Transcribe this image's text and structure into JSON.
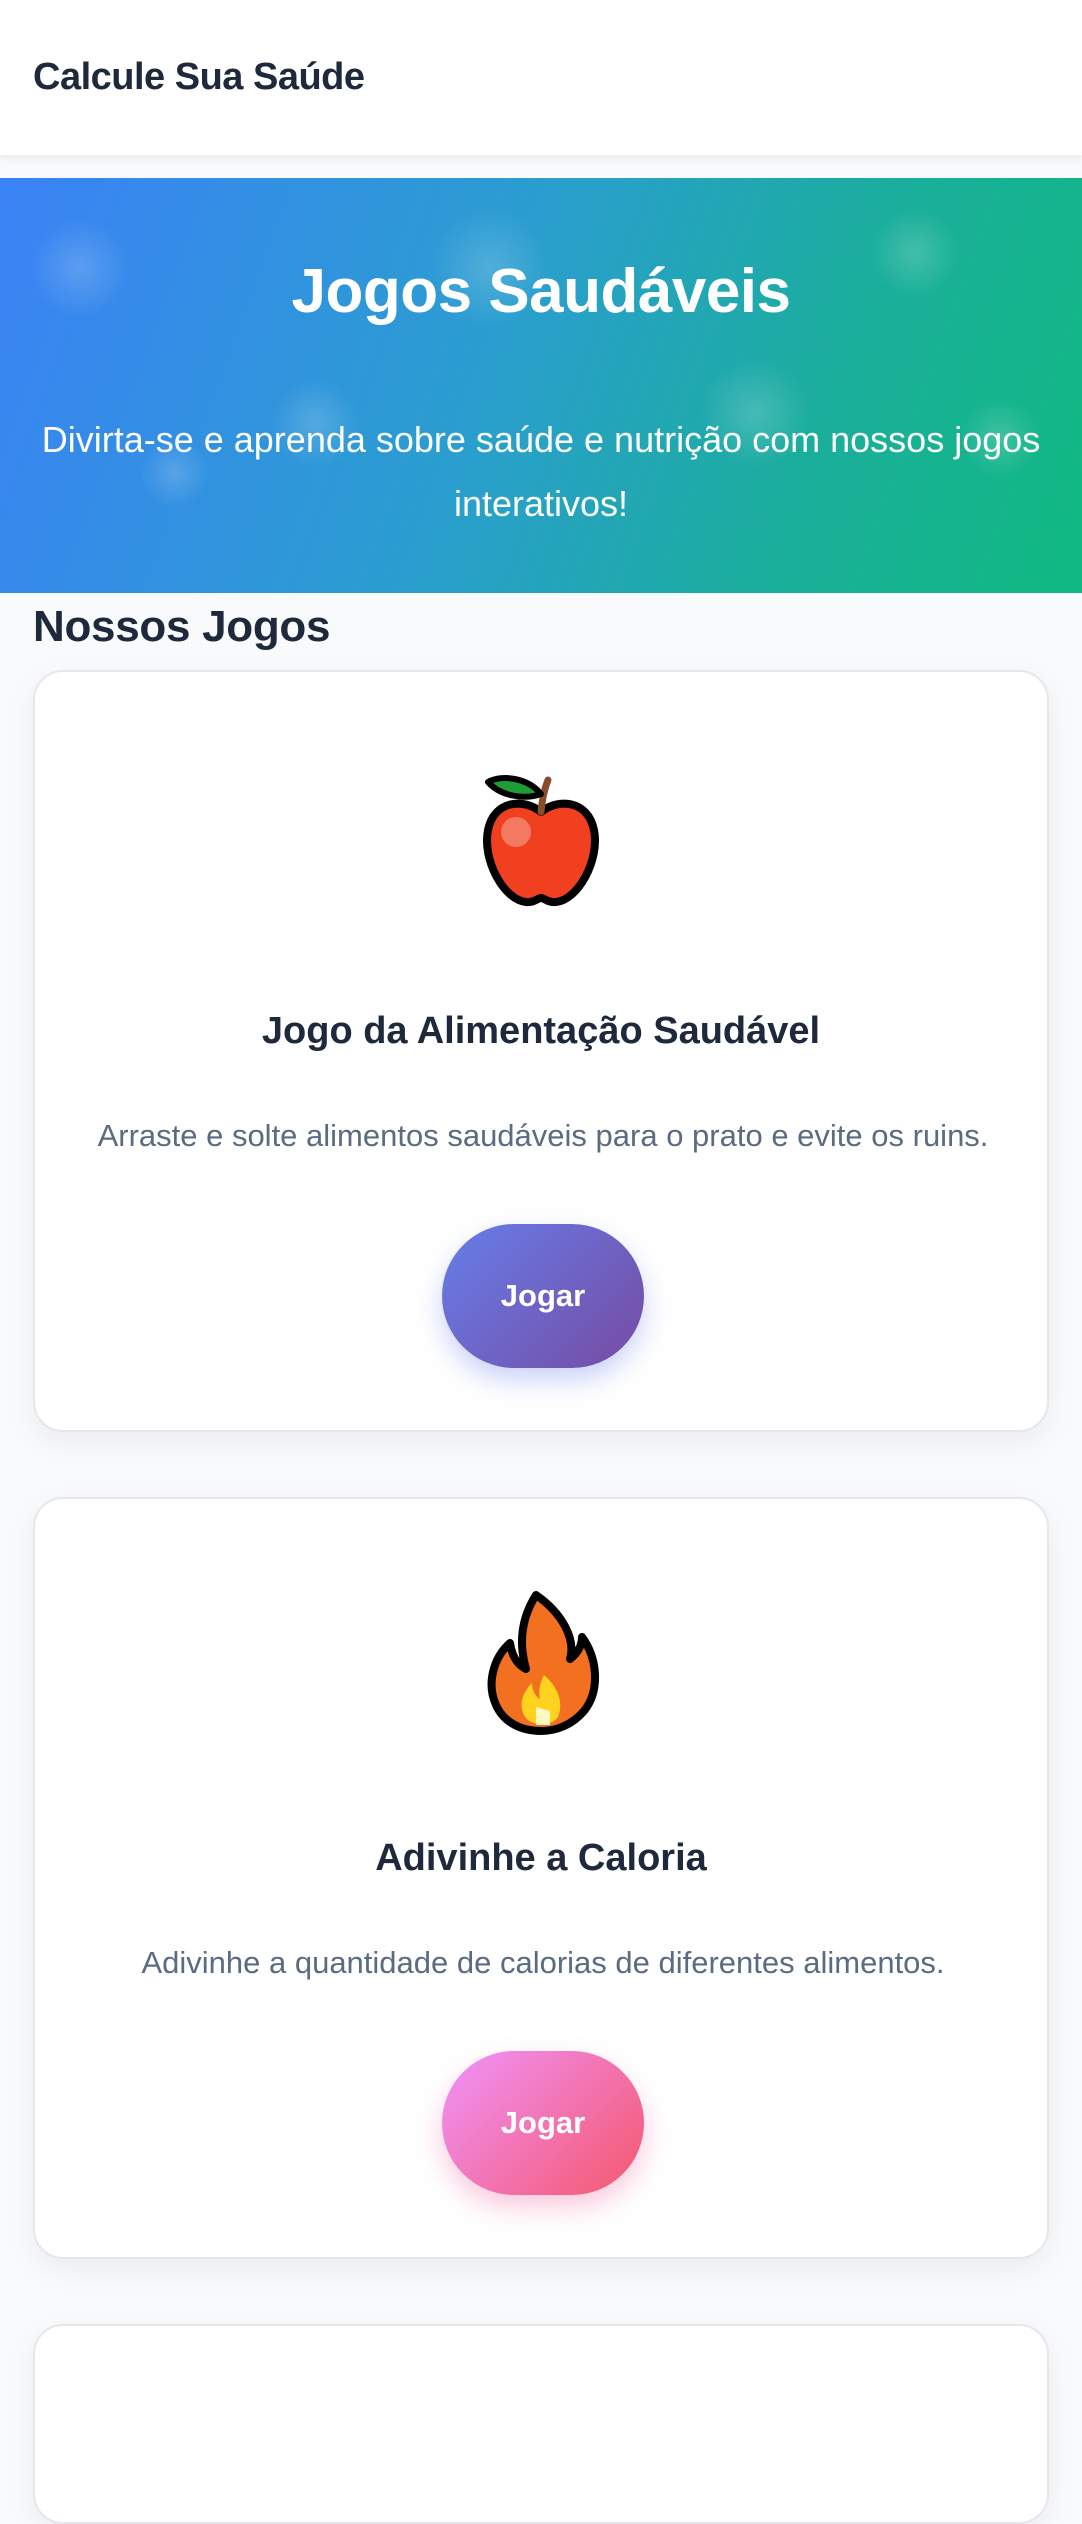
{
  "header": {
    "brand": "Calcule Sua Saúde"
  },
  "hero": {
    "title": "Jogos Saudáveis",
    "subtitle": "Divirta-se e aprenda sobre saúde e nutrição com nossos jogos interativos!",
    "gradient_start": "#3b82f6",
    "gradient_end": "#10b981"
  },
  "games_section": {
    "title": "Nossos Jogos"
  },
  "games": [
    {
      "icon": "apple-icon",
      "title": "Jogo da Alimentação Saudável",
      "description": "Arraste e solte alimentos saudáveis para o prato e evite os ruins.",
      "button_label": "Jogar",
      "button_color": "#6a5fd0"
    },
    {
      "icon": "fire-icon",
      "title": "Adivinhe a Caloria",
      "description": "Adivinhe a quantidade de calorias de diferentes alimentos.",
      "button_label": "Jogar",
      "button_color": "#f26e9c"
    }
  ]
}
